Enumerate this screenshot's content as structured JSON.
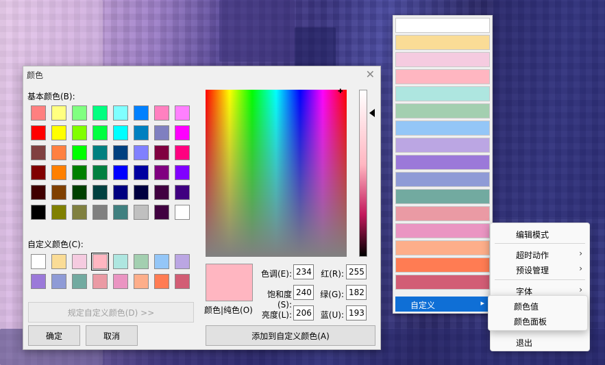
{
  "dialog": {
    "title": "颜色",
    "basic_label": "基本颜色(B):",
    "custom_label": "自定义颜色(C):",
    "define_custom_button": "规定自定义颜色(D) >>",
    "ok_button": "确定",
    "cancel_button": "取消",
    "add_custom_button": "添加到自定义颜色(A)",
    "preview_label": "颜色|纯色(O)",
    "fields": {
      "hue_label": "色调(E):",
      "hue": "234",
      "sat_label": "饱和度(S):",
      "sat": "240",
      "lum_label": "亮度(L):",
      "lum": "206",
      "red_label": "红(R):",
      "red": "255",
      "green_label": "绿(G):",
      "green": "182",
      "blue_label": "蓝(U):",
      "blue": "193"
    },
    "basic_colors": [
      "#ff8080",
      "#ffff80",
      "#80ff80",
      "#00ff80",
      "#80ffff",
      "#0080ff",
      "#ff80c0",
      "#ff80ff",
      "#ff0000",
      "#ffff00",
      "#80ff00",
      "#00ff40",
      "#00ffff",
      "#0080c0",
      "#8080c0",
      "#ff00ff",
      "#804040",
      "#ff8040",
      "#00ff00",
      "#008080",
      "#004080",
      "#8080ff",
      "#800040",
      "#ff0080",
      "#800000",
      "#ff8000",
      "#008000",
      "#008040",
      "#0000ff",
      "#0000a0",
      "#800080",
      "#8000ff",
      "#400000",
      "#804000",
      "#004000",
      "#004040",
      "#000080",
      "#000040",
      "#400040",
      "#400080",
      "#000000",
      "#808000",
      "#808040",
      "#808080",
      "#408080",
      "#c0c0c0",
      "#400040",
      "#ffffff"
    ],
    "custom_colors": [
      "#ffffff",
      "#fadc96",
      "#f5cbe0",
      "#ffb6c1",
      "#aee6e0",
      "#a3cfb0",
      "#94c6f7",
      "#bba6e3",
      "#9b79d9",
      "#8f9bd6",
      "#72aaa0",
      "#ea9aa4",
      "#ea95c2",
      "#fdae8a",
      "#ff7c53",
      "#d25d75"
    ],
    "selected_custom_index": 3
  },
  "strip": {
    "colors": [
      "#ffffff",
      "#fadc96",
      "#f5cbe0",
      "#ffb6c1",
      "#aee6e0",
      "#a3cfb0",
      "#94c6f7",
      "#bba6e3",
      "#9b79d9",
      "#8f9bd6",
      "#72aaa0",
      "#ea9aa4",
      "#ea95c2",
      "#fdae8a",
      "#ff7c53",
      "#d25d75"
    ],
    "custom_label": "自定义"
  },
  "context_menu": {
    "items": {
      "edit_mode": "编辑模式",
      "timeout_action": "超时动作",
      "preset_manage": "预设管理",
      "font": "字体",
      "exit": "退出"
    }
  },
  "submenu": {
    "color_value": "颜色值",
    "color_panel": "颜色面板"
  },
  "icons": {
    "submenu_arrow": "chevron-right-icon",
    "close": "close-icon"
  }
}
